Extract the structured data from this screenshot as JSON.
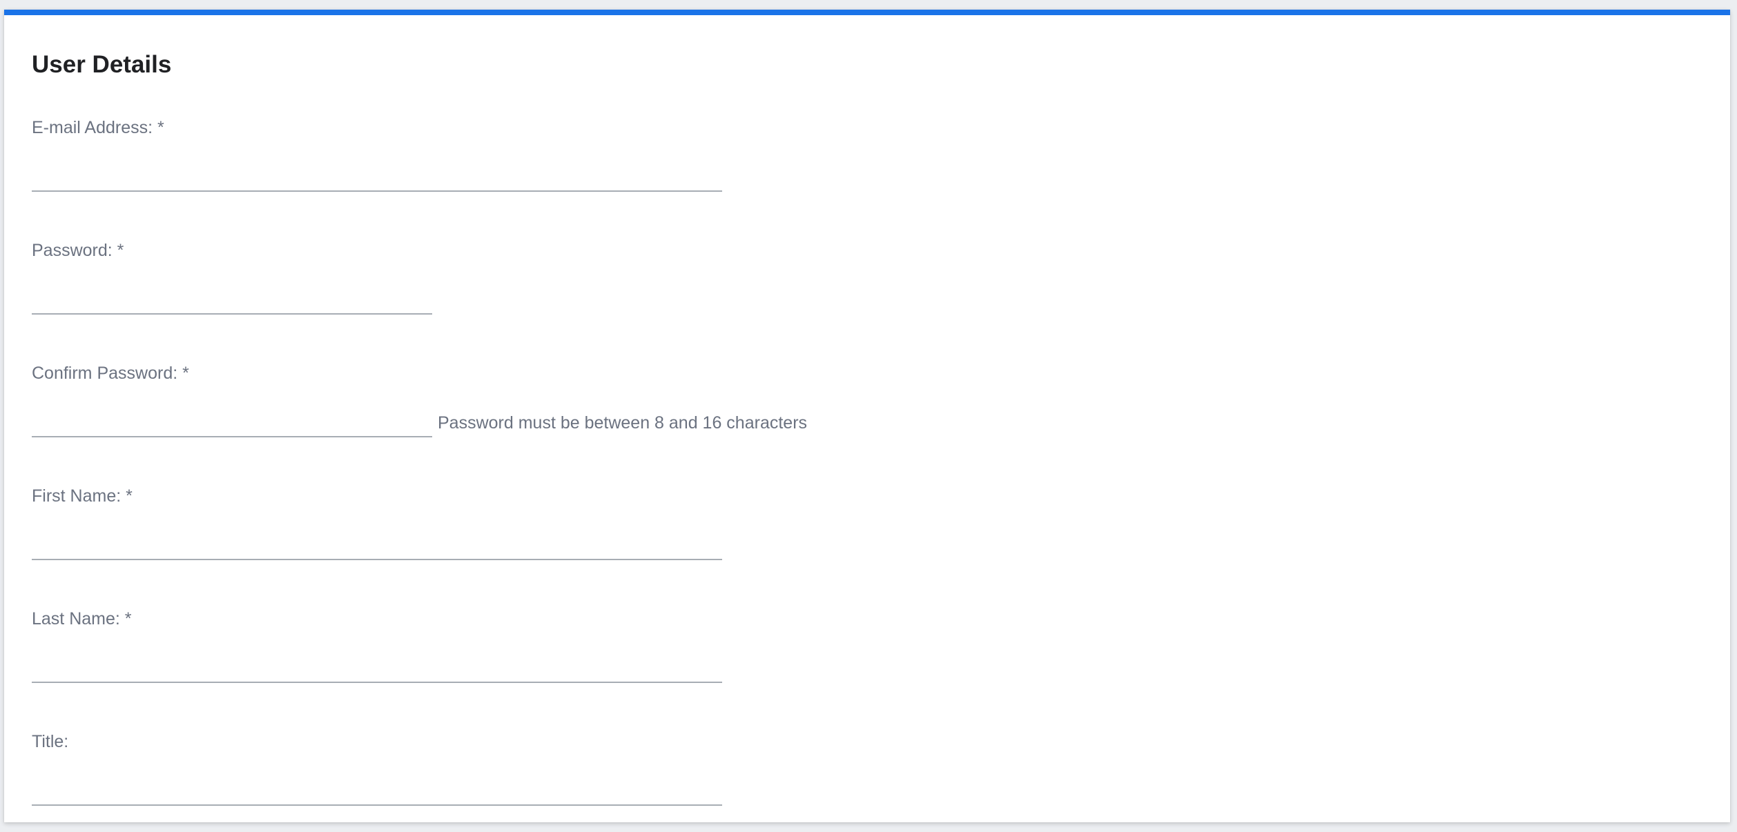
{
  "section": {
    "title": "User Details"
  },
  "fields": {
    "email": {
      "label": "E-mail Address: *",
      "value": ""
    },
    "password": {
      "label": "Password: *",
      "value": ""
    },
    "confirm_password": {
      "label": "Confirm Password: *",
      "value": "",
      "hint": "Password must be between 8 and 16 characters"
    },
    "first_name": {
      "label": "First Name: *",
      "value": ""
    },
    "last_name": {
      "label": "Last Name: *",
      "value": ""
    },
    "title": {
      "label": "Title:",
      "value": ""
    }
  },
  "colors": {
    "accent": "#1a73e8",
    "label": "#6b7280",
    "underline": "#a7adb4",
    "heading": "#202124"
  }
}
